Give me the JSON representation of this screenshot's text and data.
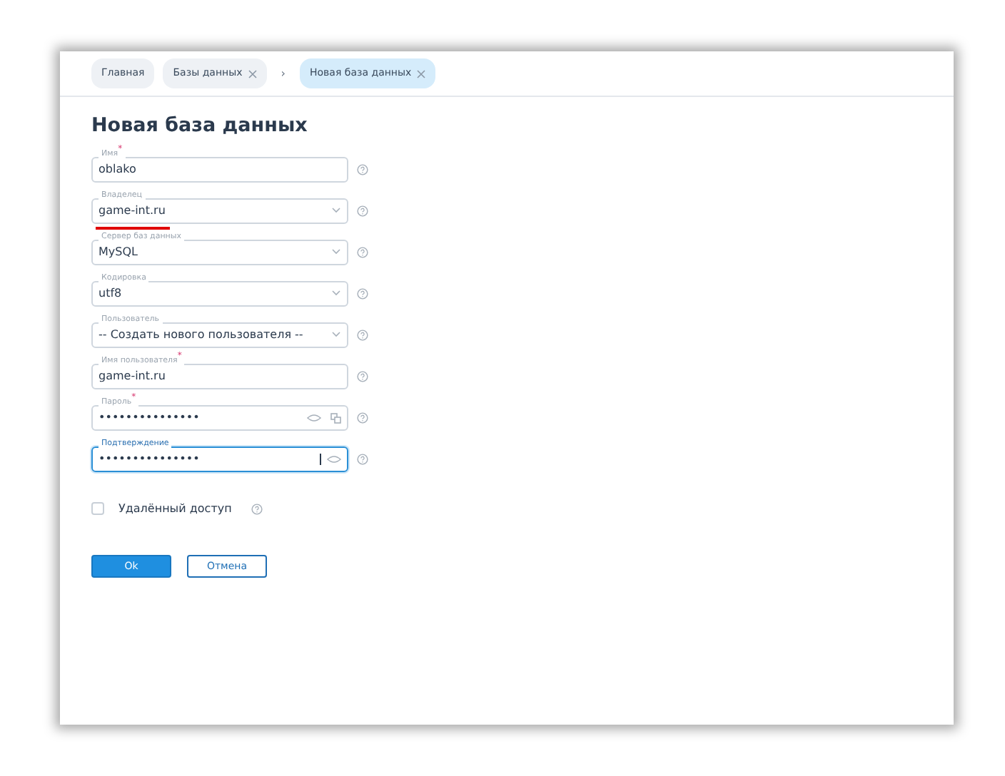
{
  "breadcrumbs": [
    {
      "kind": "tab",
      "label": "Главная",
      "closable": false,
      "selected": false
    },
    {
      "kind": "tab",
      "label": "Базы данных",
      "closable": true,
      "selected": false
    },
    {
      "kind": "separator",
      "label": "›"
    },
    {
      "kind": "tab",
      "label": "Новая база данных",
      "closable": true,
      "selected": true
    }
  ],
  "title": "Новая база данных",
  "fields": [
    {
      "kind": "text",
      "label": "Имя$^{*}$",
      "value": "oblako",
      "focused": false
    },
    {
      "kind": "select",
      "label": "Владелец",
      "value": "game-int.ru",
      "focused": false,
      "underlined": true
    },
    {
      "kind": "select",
      "label": "Сервер баз данных",
      "value": "MySQL",
      "focused": false
    },
    {
      "kind": "select",
      "label": "Кодировка",
      "value": "utf8",
      "focused": false
    },
    {
      "kind": "select",
      "label": "Пользователь",
      "value": "-- Создать нового пользователя --",
      "focused": false
    },
    {
      "kind": "text",
      "label": "Имя пользователя$^{*}$",
      "value": "game-int.ru",
      "focused": false
    },
    {
      "kind": "password",
      "label": "Пароль$^{*}$",
      "value": "•••••••••••••••",
      "focused": false,
      "generator": true
    },
    {
      "kind": "password",
      "label": "Подтверждение",
      "value": "•••••••••••••••",
      "focused": true,
      "generator": false
    }
  ],
  "remote_access": {
    "label": "Удалённый доступ",
    "checked": false
  },
  "buttons": [
    {
      "label": "Ok",
      "kind": "primary"
    },
    {
      "label": "Отмена",
      "kind": "secondary"
    }
  ]
}
